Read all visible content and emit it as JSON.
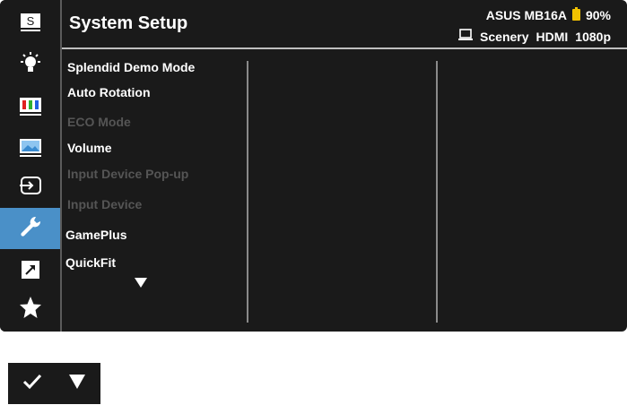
{
  "header": {
    "title": "System Setup",
    "model": "ASUS MB16A",
    "battery": "90%",
    "mode": "Scenery",
    "input": "HDMI",
    "resolution": "1080p"
  },
  "rail": [
    {
      "name": "splendid-icon",
      "glyph": "S"
    },
    {
      "name": "blue-light-filter-icon"
    },
    {
      "name": "color-icon"
    },
    {
      "name": "image-icon"
    },
    {
      "name": "input-select-icon"
    },
    {
      "name": "system-setup-icon",
      "active": true
    },
    {
      "name": "shortcut-icon"
    },
    {
      "name": "favorite-icon"
    }
  ],
  "menu": {
    "items": [
      {
        "label": "Splendid Demo Mode",
        "enabled": true
      },
      {
        "label": "Auto Rotation",
        "enabled": true
      },
      {
        "label": "ECO Mode",
        "enabled": false
      },
      {
        "label": "Volume",
        "enabled": true
      },
      {
        "label": "Input Device Pop-up",
        "enabled": false
      },
      {
        "label": "Input Device",
        "enabled": false
      },
      {
        "label": "GamePlus",
        "enabled": true
      },
      {
        "label": "QuickFit",
        "enabled": true
      }
    ]
  },
  "buttons": [
    {
      "name": "confirm-button",
      "icon": "checkmark-icon"
    },
    {
      "name": "down-button",
      "icon": "triangle-down-icon"
    }
  ],
  "colors": {
    "background": "#1a1a1a",
    "active": "#4a90c8",
    "battery": "#f2c200",
    "disabled_text": "#555555"
  }
}
